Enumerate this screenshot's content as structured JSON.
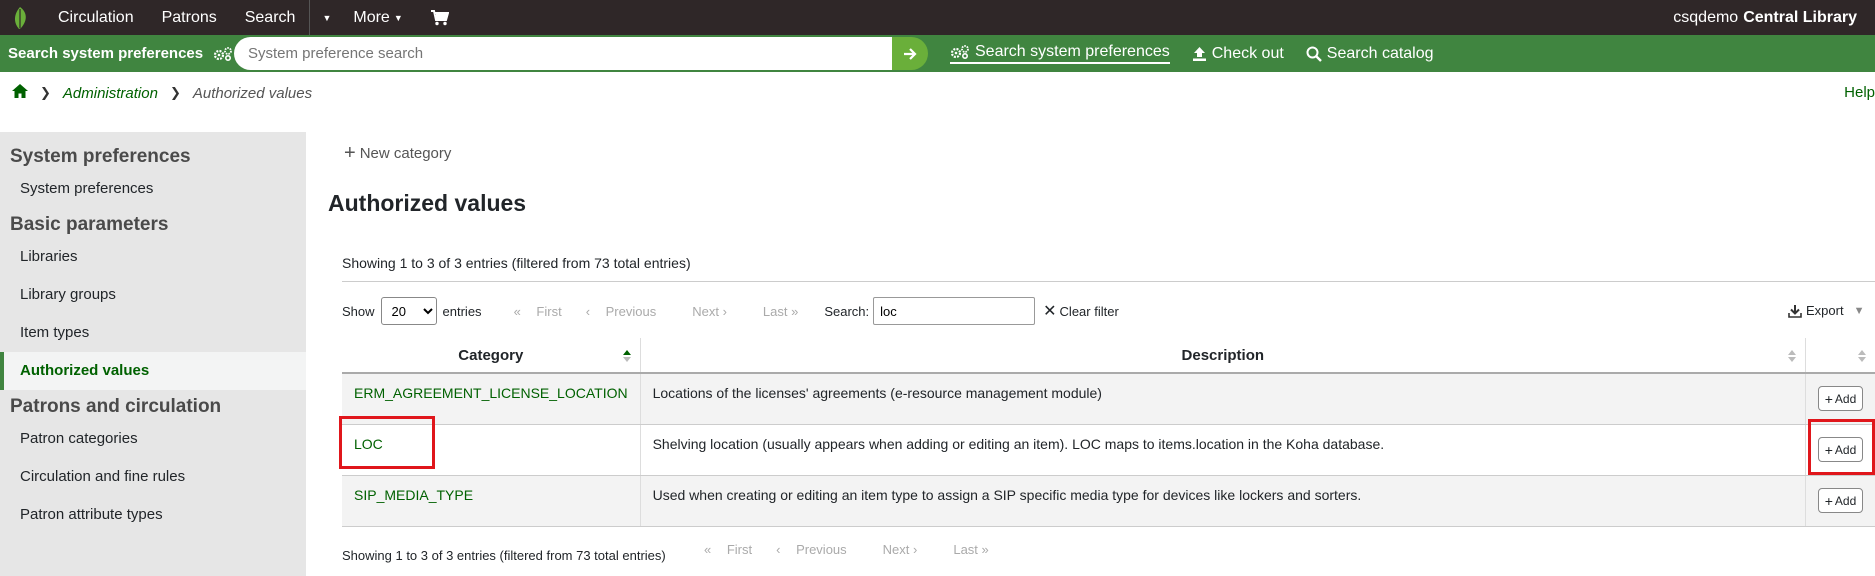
{
  "topnav": {
    "items": [
      "Circulation",
      "Patrons",
      "Search",
      "More"
    ],
    "user": "csqdemo",
    "library": "Central Library"
  },
  "searchbar": {
    "label": "Search system preferences",
    "placeholder": "System preference search",
    "links": [
      "Search system preferences",
      "Check out",
      "Search catalog"
    ]
  },
  "breadcrumb": {
    "admin": "Administration",
    "current": "Authorized values",
    "help": "Help"
  },
  "sidebar": {
    "sections": [
      {
        "title": "System preferences",
        "items": [
          "System preferences"
        ]
      },
      {
        "title": "Basic parameters",
        "items": [
          "Libraries",
          "Library groups",
          "Item types",
          "Authorized values"
        ]
      },
      {
        "title": "Patrons and circulation",
        "items": [
          "Patron categories",
          "Circulation and fine rules",
          "Patron attribute types"
        ]
      }
    ],
    "active": "Authorized values"
  },
  "main": {
    "new_category": "New category",
    "title": "Authorized values",
    "info": "Showing 1 to 3 of 3 entries (filtered from 73 total entries)",
    "show_label": "Show",
    "page_size": "20",
    "entries_label": "entries",
    "pager": {
      "first": "First",
      "previous": "Previous",
      "next": "Next",
      "last": "Last"
    },
    "search_label": "Search:",
    "search_value": "loc",
    "clear_filter": "Clear filter",
    "export": "Export"
  },
  "table": {
    "headers": [
      "Category",
      "Description",
      ""
    ],
    "add_label": "Add",
    "rows": [
      {
        "category": "ERM_AGREEMENT_LICENSE_LOCATION",
        "description": "Locations of the licenses' agreements (e-resource management module)"
      },
      {
        "category": "LOC",
        "description": "Shelving location (usually appears when adding or editing an item). LOC maps to items.location in the Koha database."
      },
      {
        "category": "SIP_MEDIA_TYPE",
        "description": "Used when creating or editing an item type to assign a SIP specific media type for devices like lockers and sorters."
      }
    ]
  },
  "colors": {
    "nav_bg": "#2f2728",
    "green": "#408540",
    "link_green": "#006100",
    "highlight": "#e0161b"
  }
}
